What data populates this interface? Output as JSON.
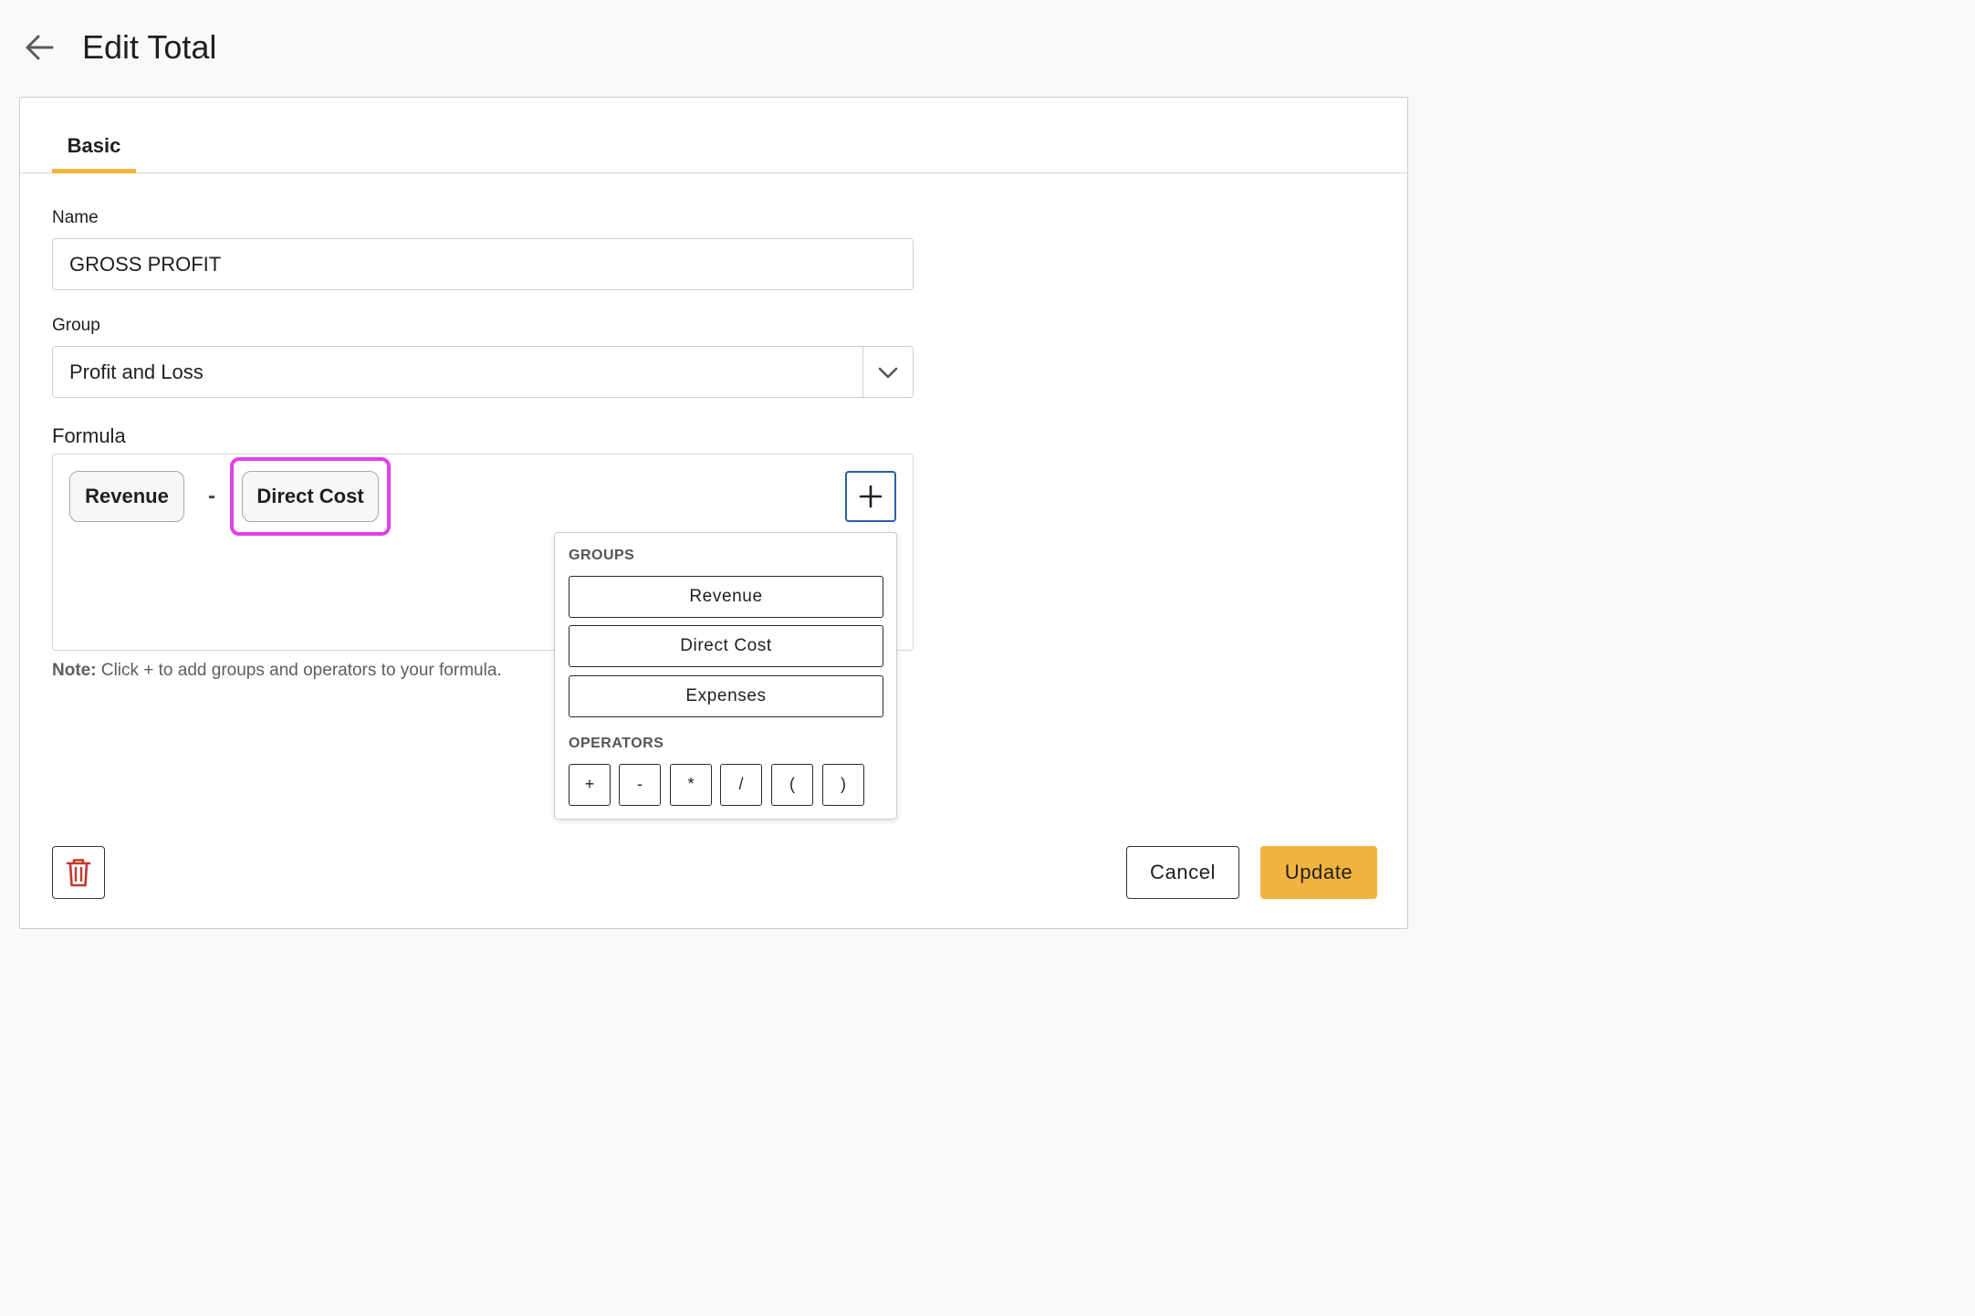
{
  "header": {
    "title": "Edit Total",
    "back_icon": "arrow-left-icon"
  },
  "tabs": [
    {
      "label": "Basic",
      "active": true
    }
  ],
  "form": {
    "name_label": "Name",
    "name_value": "GROSS PROFIT",
    "group_label": "Group",
    "group_value": "Profit and Loss",
    "formula_label": "Formula",
    "formula_tokens": {
      "first": "Revenue",
      "operator": "-",
      "second": "Direct Cost"
    },
    "note_bold": "Note:",
    "note_text": " Click + to add groups and operators to your formula."
  },
  "dropdown": {
    "groups_heading": "GROUPS",
    "groups": [
      "Revenue",
      "Direct Cost",
      "Expenses"
    ],
    "operators_heading": "OPERATORS",
    "operators": [
      "+",
      "-",
      "*",
      "/",
      "(",
      ")"
    ]
  },
  "footer": {
    "cancel_label": "Cancel",
    "update_label": "Update",
    "delete_icon": "trash-icon"
  },
  "colors": {
    "accent": "#f2b441",
    "highlight": "#e23fe8",
    "add_border": "#2f5ea8",
    "delete_icon": "#c0392b"
  }
}
